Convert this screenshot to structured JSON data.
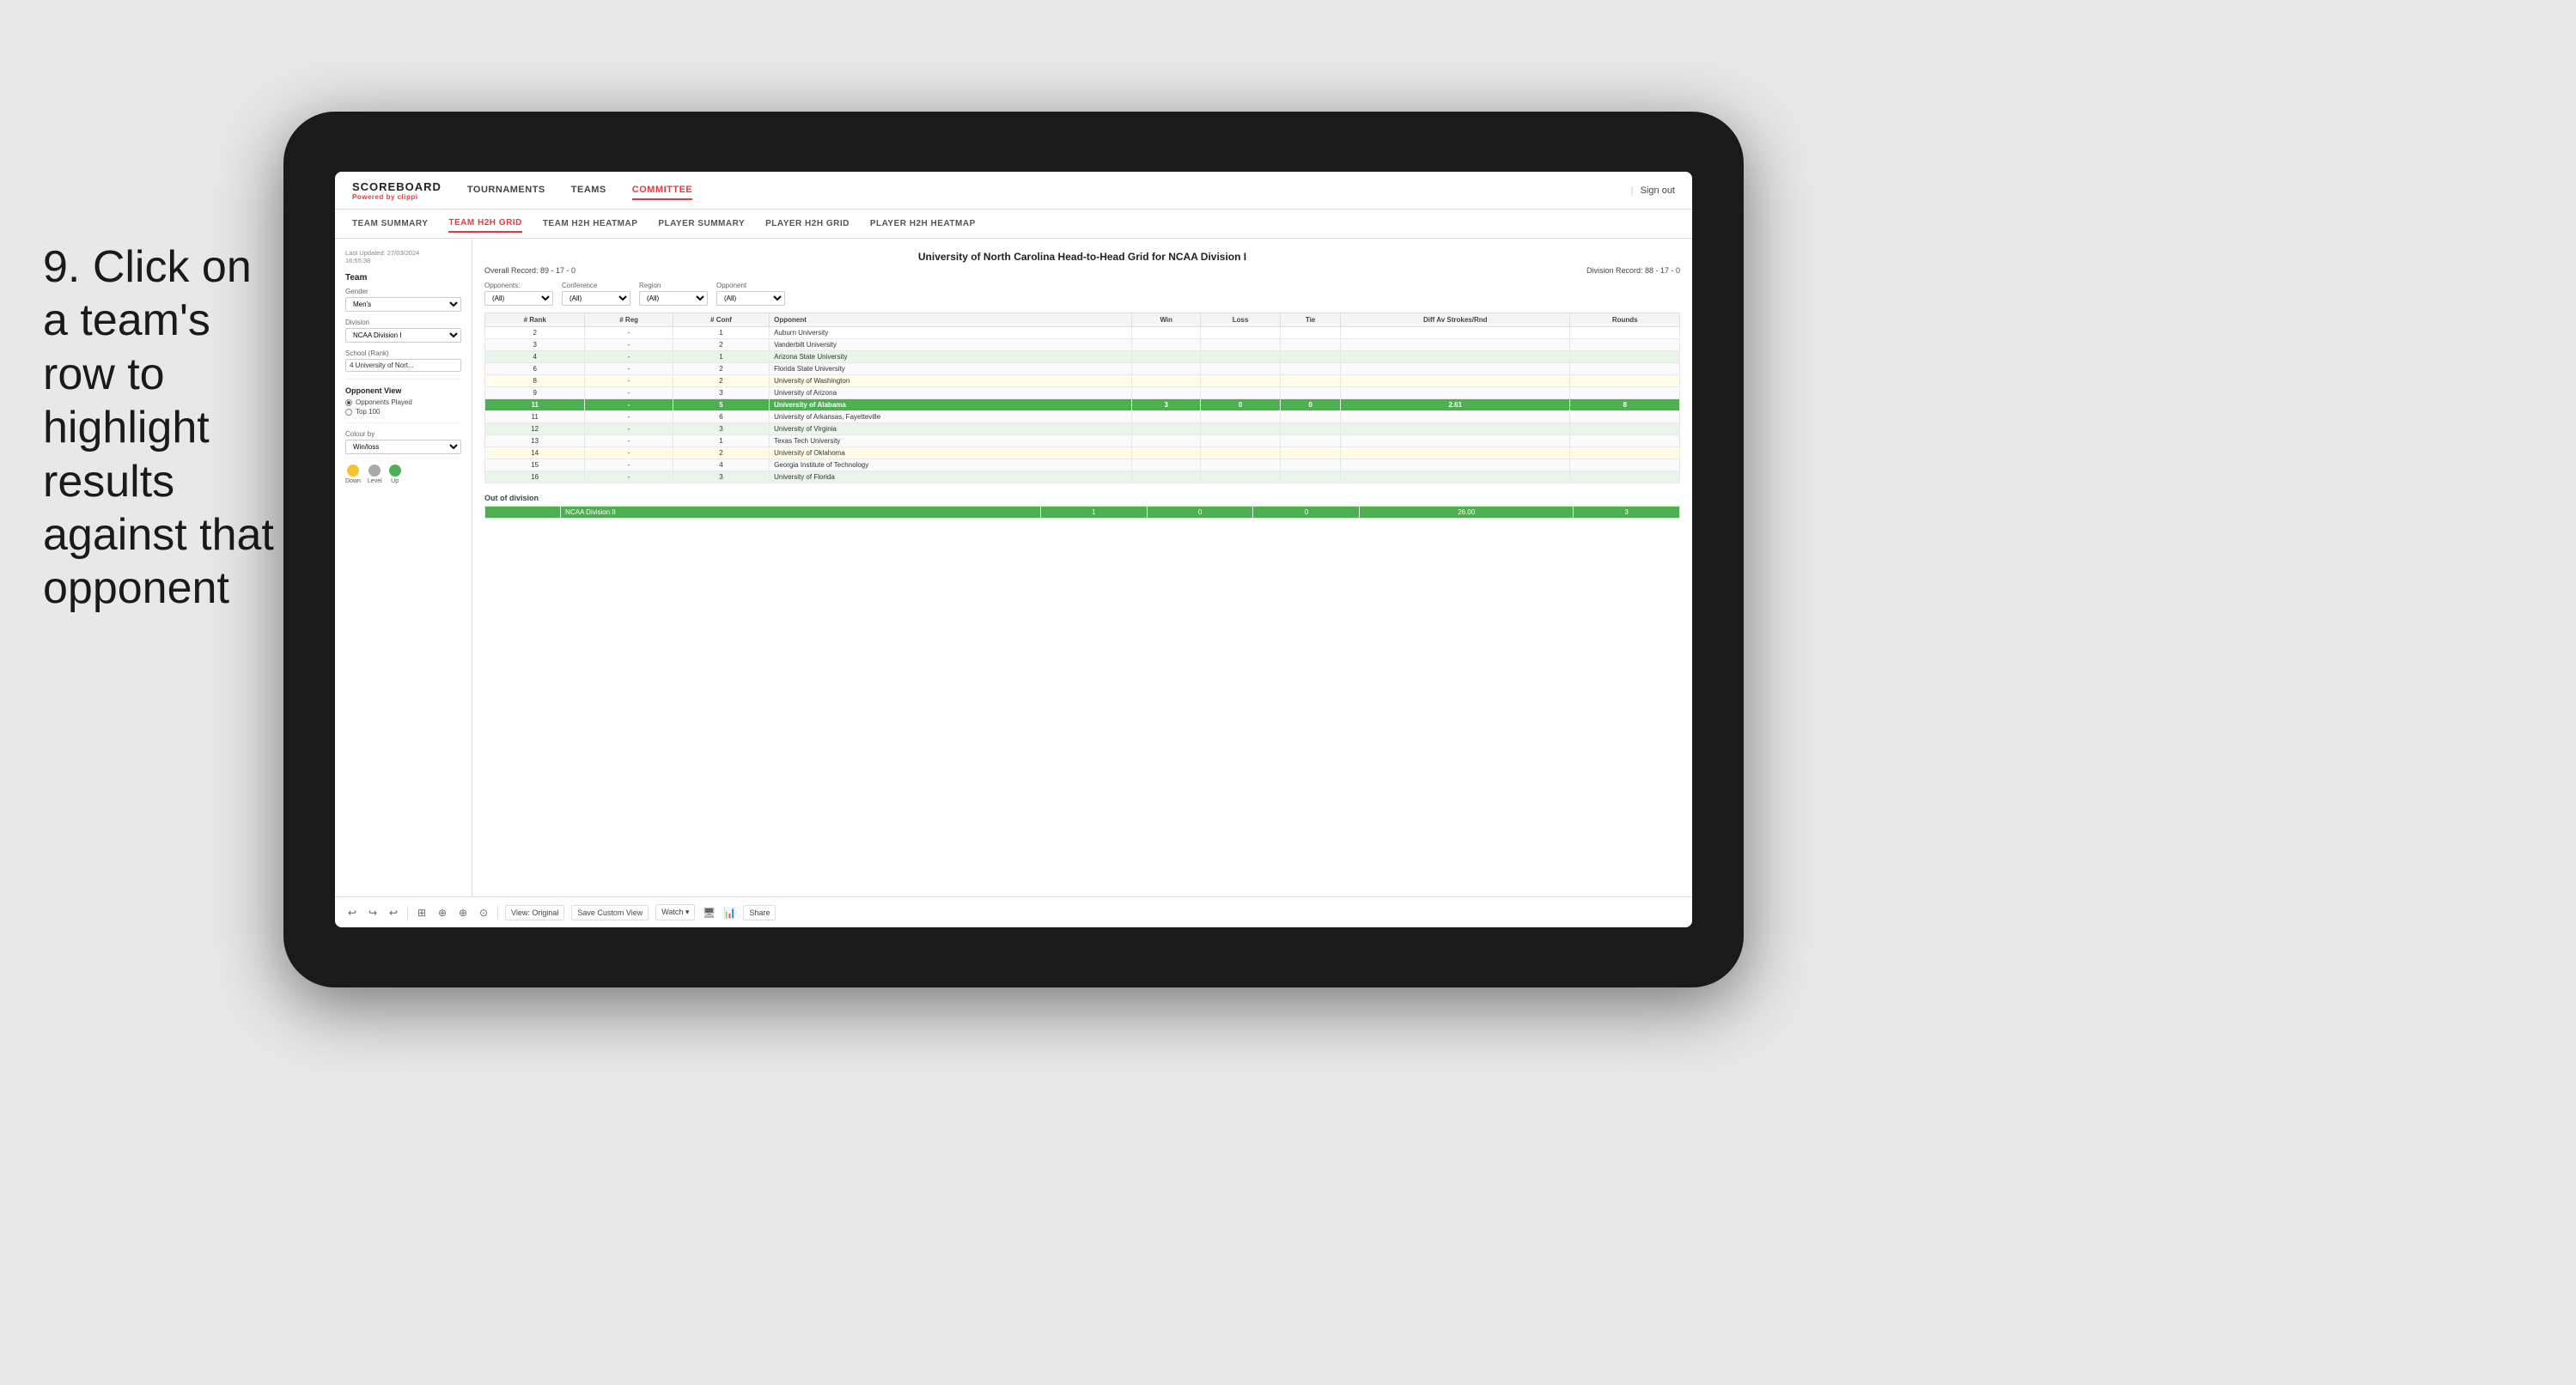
{
  "instruction": {
    "step": "9.",
    "text": "Click on a team's row to highlight results against that opponent"
  },
  "nav": {
    "logo_main": "SCOREBOARD",
    "logo_sub": "Powered by ",
    "logo_brand": "clippi",
    "links": [
      "TOURNAMENTS",
      "TEAMS",
      "COMMITTEE"
    ],
    "active_link": "COMMITTEE",
    "sign_out": "Sign out"
  },
  "sub_nav": {
    "links": [
      "TEAM SUMMARY",
      "TEAM H2H GRID",
      "TEAM H2H HEATMAP",
      "PLAYER SUMMARY",
      "PLAYER H2H GRID",
      "PLAYER H2H HEATMAP"
    ],
    "active_link": "TEAM H2H GRID"
  },
  "left_panel": {
    "timestamp_label": "Last Updated: 27/03/2024",
    "timestamp_time": "16:55:38",
    "team_label": "Team",
    "gender_label": "Gender",
    "gender_value": "Men's",
    "division_label": "Division",
    "division_value": "NCAA Division I",
    "school_label": "School (Rank)",
    "school_value": "4 University of Nort...",
    "opponent_view_title": "Opponent View",
    "opponent_options": [
      "Opponents Played",
      "Top 100"
    ],
    "opponent_selected": "Opponents Played",
    "colour_by_label": "Colour by",
    "colour_by_value": "Win/loss",
    "legend": [
      {
        "label": "Down",
        "color": "#f4c430"
      },
      {
        "label": "Level",
        "color": "#aaa"
      },
      {
        "label": "Up",
        "color": "#4caf50"
      }
    ]
  },
  "grid": {
    "title": "University of North Carolina Head-to-Head Grid for NCAA Division I",
    "overall_record": "Overall Record: 89 - 17 - 0",
    "division_record": "Division Record: 88 - 17 - 0",
    "filter_opponents_label": "Opponents:",
    "filter_opponents_value": "(All)",
    "filter_region_label": "Region",
    "filter_region_value": "(All)",
    "filter_opponent_label": "Opponent",
    "filter_opponent_value": "(All)",
    "columns": [
      "# Rank",
      "# Reg",
      "# Conf",
      "Opponent",
      "Win",
      "Loss",
      "Tie",
      "Diff Av Strokes/Rnd",
      "Rounds"
    ],
    "rows": [
      {
        "rank": "2",
        "reg": "-",
        "conf": "1",
        "opponent": "Auburn University",
        "win": "",
        "loss": "",
        "tie": "",
        "diff": "",
        "rounds": "",
        "style": "normal"
      },
      {
        "rank": "3",
        "reg": "-",
        "conf": "2",
        "opponent": "Vanderbilt University",
        "win": "",
        "loss": "",
        "tie": "",
        "diff": "",
        "rounds": "",
        "style": "light-green"
      },
      {
        "rank": "4",
        "reg": "-",
        "conf": "1",
        "opponent": "Arizona State University",
        "win": "",
        "loss": "",
        "tie": "",
        "diff": "",
        "rounds": "",
        "style": "light-green"
      },
      {
        "rank": "6",
        "reg": "-",
        "conf": "2",
        "opponent": "Florida State University",
        "win": "",
        "loss": "",
        "tie": "",
        "diff": "",
        "rounds": "",
        "style": "light-green"
      },
      {
        "rank": "8",
        "reg": "-",
        "conf": "2",
        "opponent": "University of Washington",
        "win": "",
        "loss": "",
        "tie": "",
        "diff": "",
        "rounds": "",
        "style": "light-yellow"
      },
      {
        "rank": "9",
        "reg": "-",
        "conf": "3",
        "opponent": "University of Arizona",
        "win": "",
        "loss": "",
        "tie": "",
        "diff": "",
        "rounds": "",
        "style": "light-yellow"
      },
      {
        "rank": "11",
        "reg": "-",
        "conf": "5",
        "opponent": "University of Alabama",
        "win": "3",
        "loss": "0",
        "tie": "0",
        "diff": "2.61",
        "rounds": "8",
        "style": "highlighted"
      },
      {
        "rank": "11",
        "reg": "-",
        "conf": "6",
        "opponent": "University of Arkansas, Fayetteville",
        "win": "",
        "loss": "",
        "tie": "",
        "diff": "",
        "rounds": "",
        "style": "light-green"
      },
      {
        "rank": "12",
        "reg": "-",
        "conf": "3",
        "opponent": "University of Virginia",
        "win": "",
        "loss": "",
        "tie": "",
        "diff": "",
        "rounds": "",
        "style": "light-green"
      },
      {
        "rank": "13",
        "reg": "-",
        "conf": "1",
        "opponent": "Texas Tech University",
        "win": "",
        "loss": "",
        "tie": "",
        "diff": "",
        "rounds": "",
        "style": "light-green"
      },
      {
        "rank": "14",
        "reg": "-",
        "conf": "2",
        "opponent": "University of Oklahoma",
        "win": "",
        "loss": "",
        "tie": "",
        "diff": "",
        "rounds": "",
        "style": "light-yellow"
      },
      {
        "rank": "15",
        "reg": "-",
        "conf": "4",
        "opponent": "Georgia Institute of Technology",
        "win": "",
        "loss": "",
        "tie": "",
        "diff": "",
        "rounds": "",
        "style": "light-green"
      },
      {
        "rank": "16",
        "reg": "-",
        "conf": "3",
        "opponent": "University of Florida",
        "win": "",
        "loss": "",
        "tie": "",
        "diff": "",
        "rounds": "",
        "style": "light-green"
      }
    ],
    "out_of_division_label": "Out of division",
    "out_of_division_rows": [
      {
        "label": "NCAA Division II",
        "win": "1",
        "loss": "0",
        "tie": "0",
        "diff": "26.00",
        "rounds": "3",
        "style": "highlighted"
      }
    ]
  },
  "toolbar": {
    "icons": [
      "↩",
      "↪",
      "↩",
      "⊞",
      "⊕",
      "⊕",
      "⊙"
    ],
    "view_label": "View: Original",
    "save_label": "Save Custom View",
    "watch_label": "Watch ▾",
    "icon1": "🖥",
    "icon2": "📊",
    "share_label": "Share"
  },
  "colors": {
    "highlighted_green": "#4caf50",
    "light_green": "#e8f5e9",
    "light_yellow": "#fffde7",
    "accent_red": "#e63946",
    "legend_down": "#f4c430",
    "legend_level": "#aaa",
    "legend_up": "#4caf50"
  }
}
